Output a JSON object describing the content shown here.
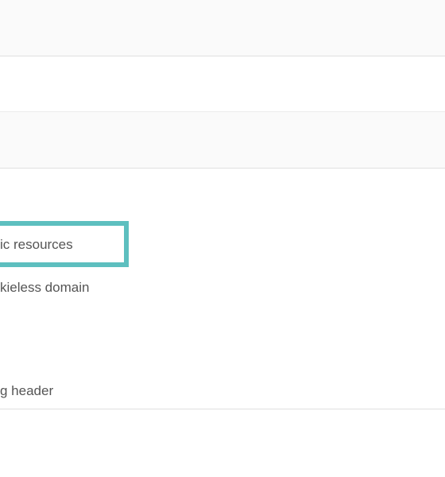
{
  "rows": {
    "row1": "",
    "row2": "",
    "row3": ""
  },
  "items": {
    "item1": "ic resources",
    "item2": "kieless domain",
    "item3": "g header"
  },
  "colors": {
    "highlight": "#5dbfbf",
    "border": "#e0e0e0",
    "text": "#555555",
    "altBg": "#fafafa"
  }
}
